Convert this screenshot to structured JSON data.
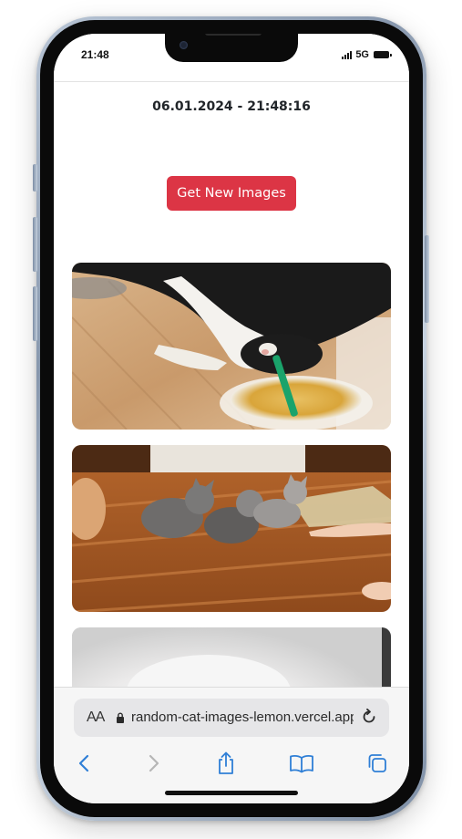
{
  "status_bar": {
    "time": "21:48",
    "network": "5G"
  },
  "page": {
    "timestamp": "06.01.2024 - 21:48:16",
    "button_label": "Get New Images",
    "button_color": "#dc3545",
    "images": [
      {
        "name": "cat-drinking-from-cup-image"
      },
      {
        "name": "kittens-on-wooden-floor-image"
      },
      {
        "name": "white-fluffy-cat-image"
      }
    ]
  },
  "browser": {
    "text_size_label": "AA",
    "url": "random-cat-images-lemon.vercel.app",
    "accent_color": "#2f7fd6",
    "toolbar_icons": [
      "back-icon",
      "forward-icon",
      "share-icon",
      "bookmarks-icon",
      "tabs-icon"
    ]
  }
}
